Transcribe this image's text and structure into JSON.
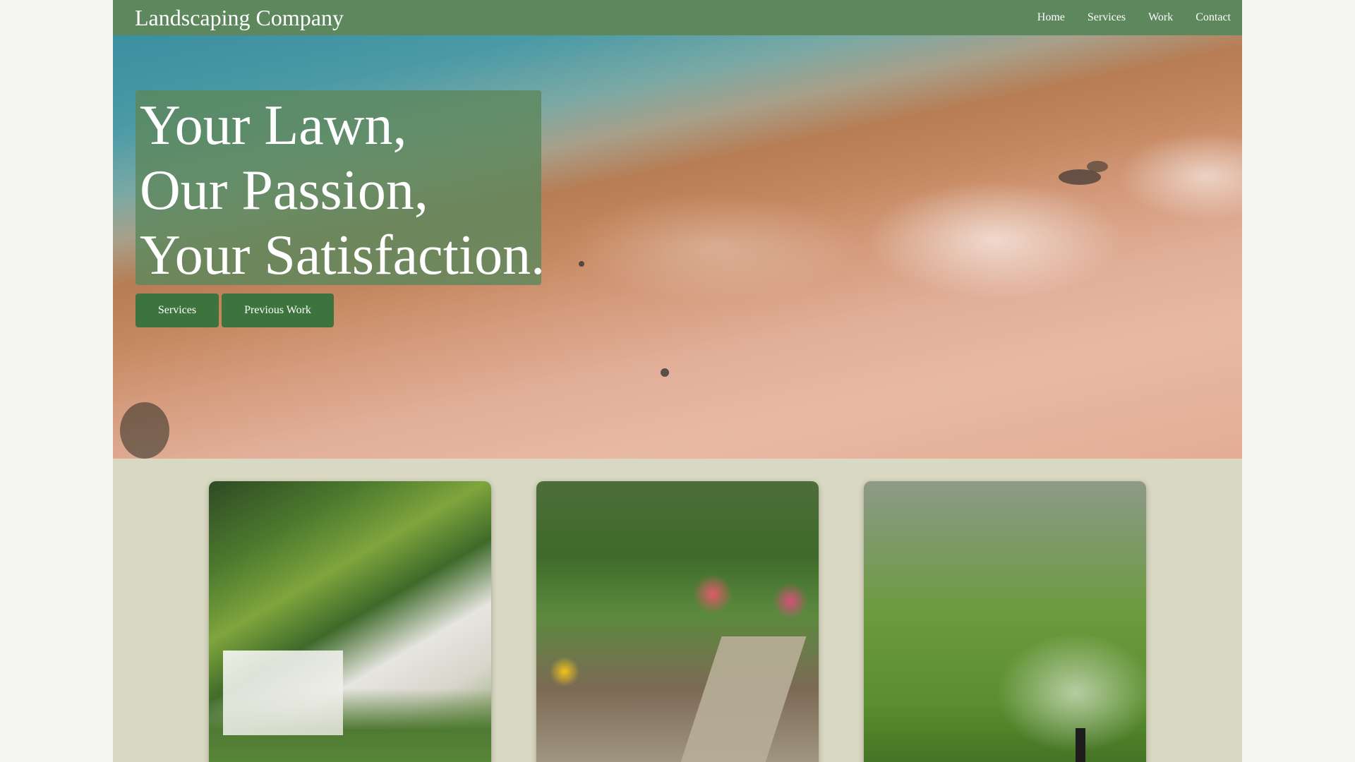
{
  "header": {
    "brand": "Landscaping Company",
    "nav": [
      "Home",
      "Services",
      "Work",
      "Contact"
    ]
  },
  "hero": {
    "headline_lines": [
      "Your Lawn,",
      "Our Passion,",
      "Your Satisfaction."
    ],
    "buttons": {
      "services": "Services",
      "previous_work": "Previous Work"
    }
  },
  "colors": {
    "header_bg": "#5d875d",
    "button_bg": "#3d743d",
    "page_bg": "#d9d8c2",
    "outer_bg": "#f5f5f1"
  }
}
